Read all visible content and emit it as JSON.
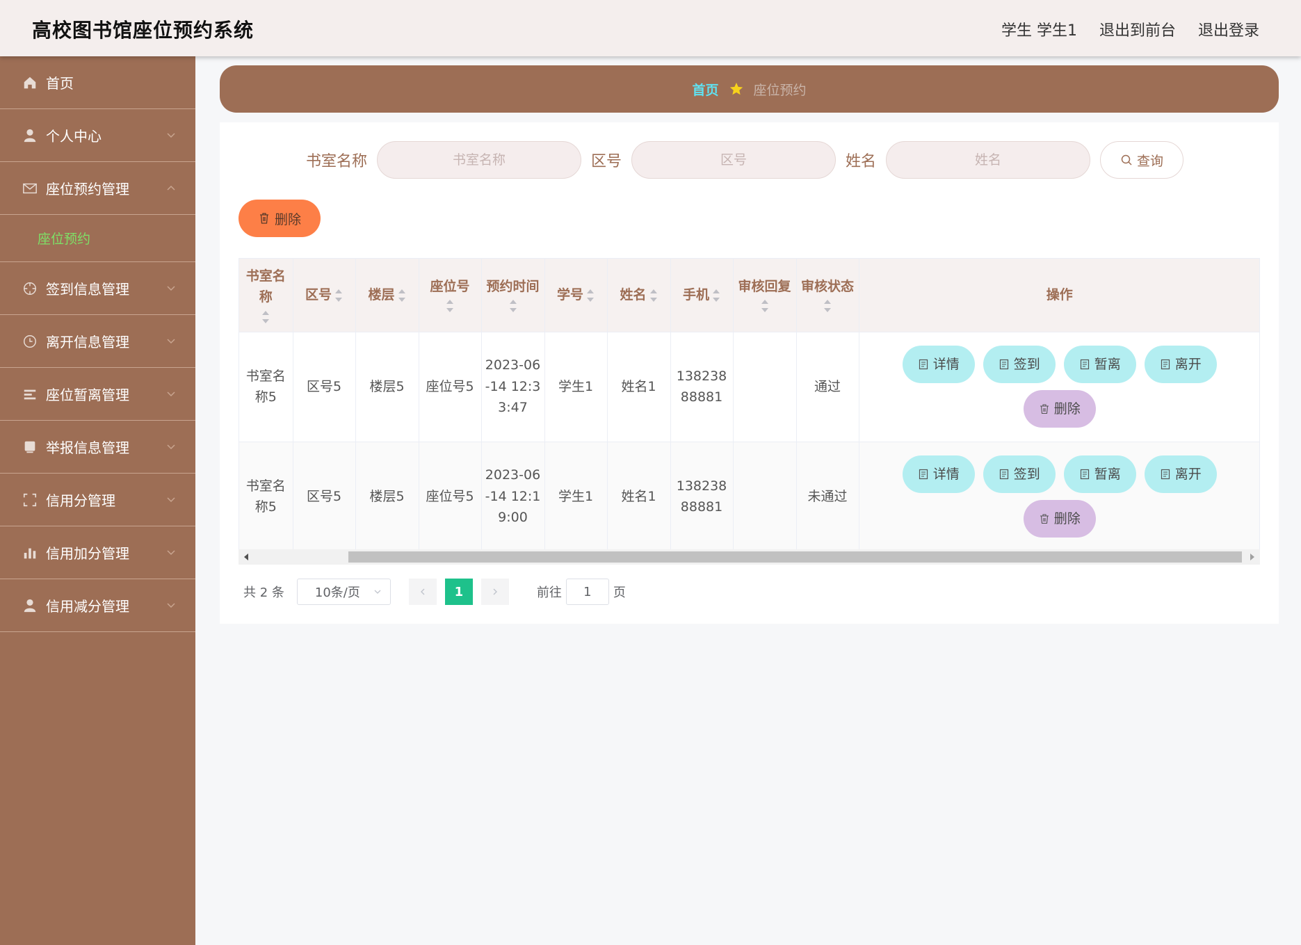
{
  "header": {
    "title": "高校图书馆座位预约系统",
    "user": "学生 学生1",
    "to_front": "退出到前台",
    "logout": "退出登录"
  },
  "sidebar": {
    "items": [
      {
        "label": "首页",
        "icon": "home-icon"
      },
      {
        "label": "个人中心",
        "icon": "user-icon"
      },
      {
        "label": "座位预约管理",
        "icon": "mail-icon",
        "expanded": true,
        "children": [
          "座位预约"
        ]
      },
      {
        "label": "签到信息管理",
        "icon": "compass-icon"
      },
      {
        "label": "离开信息管理",
        "icon": "clock-icon"
      },
      {
        "label": "座位暂离管理",
        "icon": "list-icon"
      },
      {
        "label": "举报信息管理",
        "icon": "tablet-icon"
      },
      {
        "label": "信用分管理",
        "icon": "fullscreen-icon"
      },
      {
        "label": "信用加分管理",
        "icon": "bar-chart-icon"
      },
      {
        "label": "信用减分管理",
        "icon": "user-icon"
      }
    ]
  },
  "breadcrumb": {
    "home": "首页",
    "current": "座位预约"
  },
  "search": {
    "room_label": "书室名称",
    "room_placeholder": "书室名称",
    "zone_label": "区号",
    "zone_placeholder": "区号",
    "name_label": "姓名",
    "name_placeholder": "姓名",
    "query": "查询"
  },
  "toolbar": {
    "delete": "删除"
  },
  "table": {
    "columns": [
      "书室名称",
      "区号",
      "楼层",
      "座位号",
      "预约时间",
      "学号",
      "姓名",
      "手机",
      "审核回复",
      "审核状态",
      "操作"
    ],
    "rows": [
      {
        "room": "书室名称5",
        "zone": "区号5",
        "floor": "楼层5",
        "seat": "座位号5",
        "time": "2023-06-14 12:33:47",
        "student_no": "学生1",
        "name": "姓名1",
        "phone": "13823888881",
        "reply": "",
        "status": "通过"
      },
      {
        "room": "书室名称5",
        "zone": "区号5",
        "floor": "楼层5",
        "seat": "座位号5",
        "time": "2023-06-14 12:19:00",
        "student_no": "学生1",
        "name": "姓名1",
        "phone": "13823888881",
        "reply": "",
        "status": "未通过"
      }
    ],
    "actions": {
      "detail": "详情",
      "checkin": "签到",
      "away": "暂离",
      "leave": "离开",
      "delete": "删除"
    }
  },
  "pagination": {
    "total": "共 2 条",
    "page_size": "10条/页",
    "current": "1",
    "goto_prefix": "前往",
    "goto_value": "1",
    "goto_suffix": "页"
  },
  "colors": {
    "sidebar": "#9d6e55",
    "accent_green": "#1ec18b",
    "delete_orange": "#fd7f47",
    "action_cyan": "#b3eef1",
    "action_purple": "#d7bde3"
  }
}
